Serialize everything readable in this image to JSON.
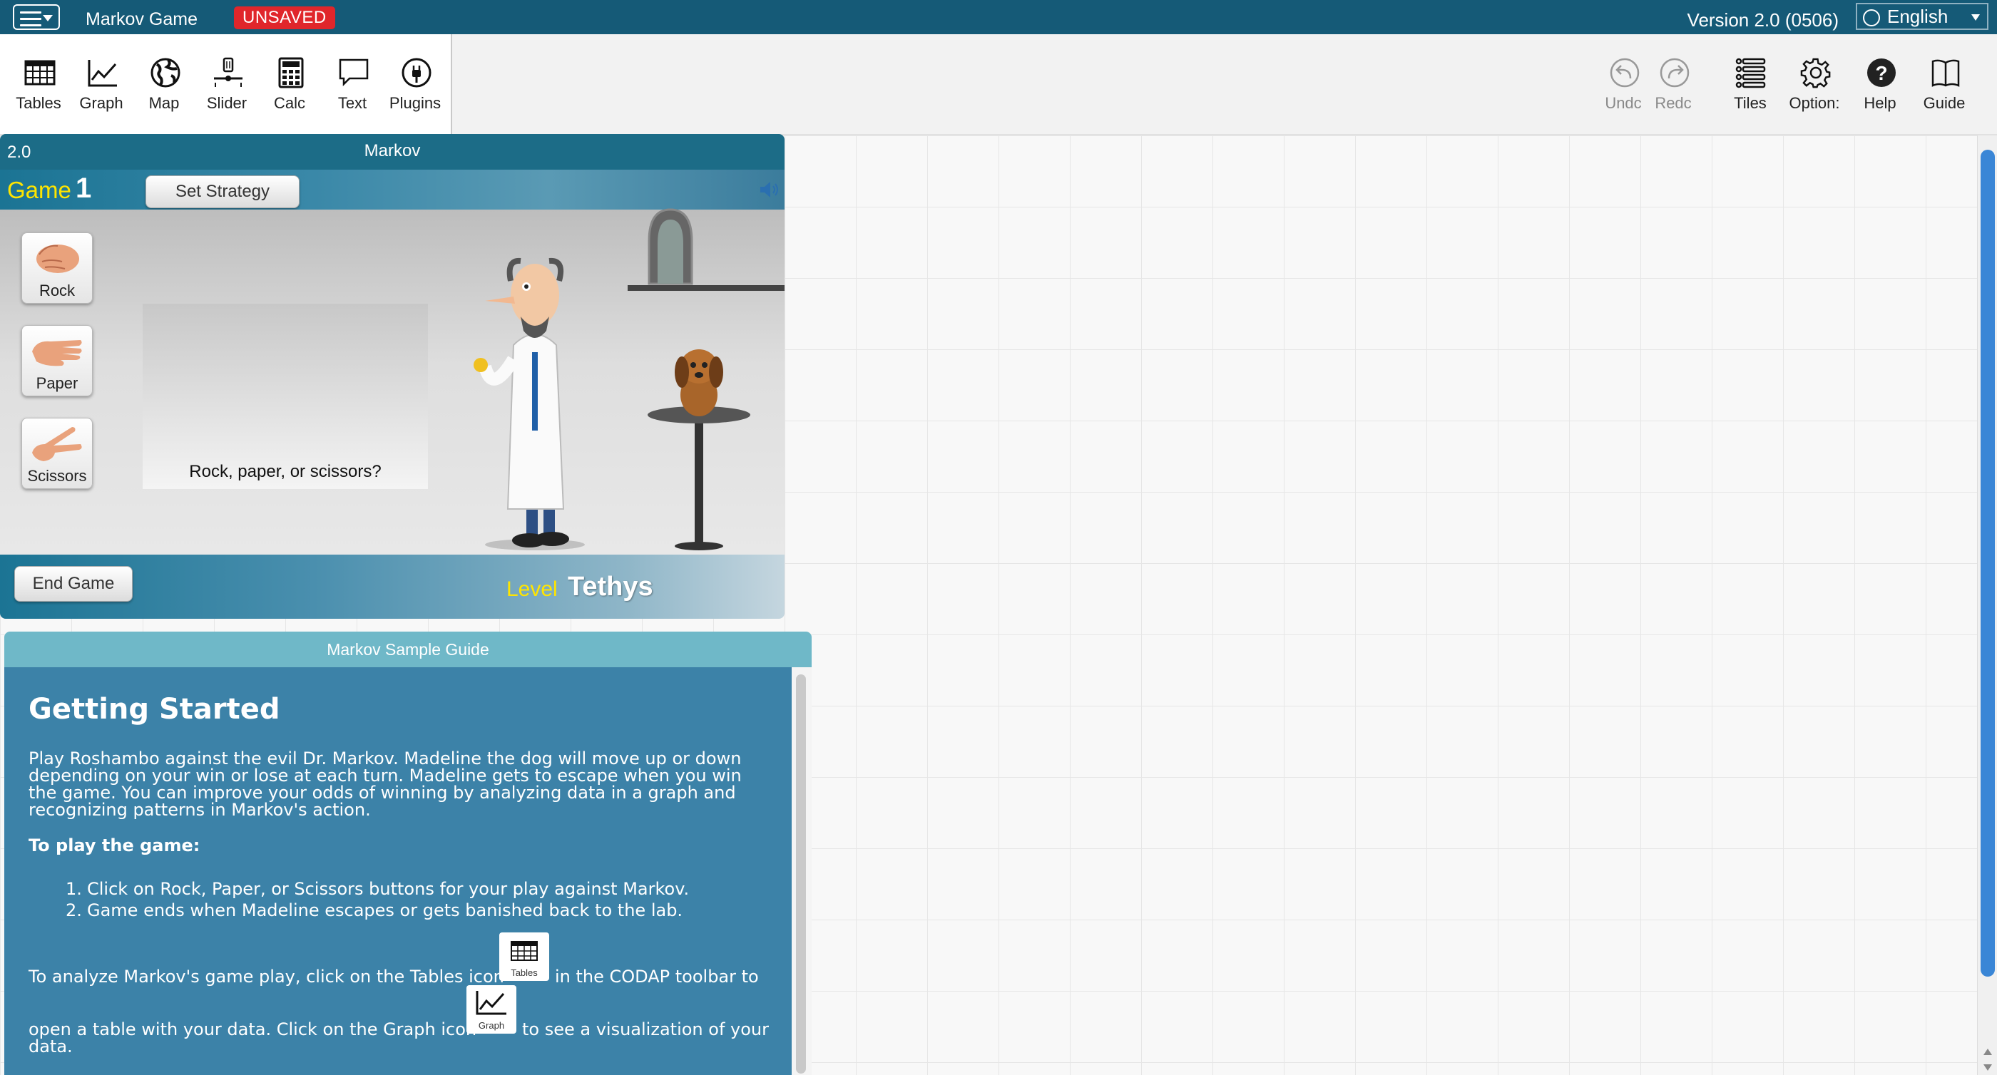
{
  "topbar": {
    "doc_title": "Markov Game",
    "unsaved_badge": "UNSAVED",
    "version": "Version 2.0 (0506)",
    "language": "English",
    "colors": {
      "bar": "#155a77",
      "unsaved": "#e0262b"
    }
  },
  "toolshelf": {
    "left": [
      {
        "label": "Tables",
        "icon": "table-icon"
      },
      {
        "label": "Graph",
        "icon": "graph-icon"
      },
      {
        "label": "Map",
        "icon": "globe-icon"
      },
      {
        "label": "Slider",
        "icon": "slider-icon"
      },
      {
        "label": "Calc",
        "icon": "calculator-icon"
      },
      {
        "label": "Text",
        "icon": "speech-bubble-icon"
      },
      {
        "label": "Plugins",
        "icon": "plug-icon"
      }
    ],
    "right": [
      {
        "label": "Undc",
        "icon": "undo-icon"
      },
      {
        "label": "Redc",
        "icon": "redo-icon"
      },
      {
        "label": "Tiles",
        "icon": "tiles-list-icon"
      },
      {
        "label": "Option:",
        "icon": "gear-icon"
      },
      {
        "label": "Help",
        "icon": "help-icon"
      },
      {
        "label": "Guide",
        "icon": "book-icon"
      }
    ]
  },
  "game_tile": {
    "version": "2.0",
    "title": "Markov",
    "game_label": "Game",
    "game_number": "1",
    "set_strategy": "Set Strategy",
    "hands": [
      "Rock",
      "Paper",
      "Scissors"
    ],
    "prompt": "Rock, paper, or scissors?",
    "end_game": "End Game",
    "level_label": "Level",
    "level_name": "Tethys"
  },
  "guide_tile": {
    "title": "Markov Sample Guide",
    "heading": "Getting Started",
    "intro": "Play Roshambo against the evil Dr. Markov. Madeline the dog will move up or down depending on your win or lose at each turn. Madeline gets to escape when you win the game. You can improve your odds of winning by analyzing data in a graph and recognizing patterns in Markov's action.",
    "to_play": "To play the game:",
    "steps": [
      "Click on Rock, Paper, or Scissors buttons for your play against Markov.",
      "Game ends when Madeline escapes or gets banished back to the lab."
    ],
    "analyze_part1": "To analyze Markov's game play, click on the Tables icon",
    "analyze_part2": "in the CODAP toolbar to",
    "analyze_part3": "open a table with your data. Click on the Graph icon",
    "analyze_part4": "to see a visualization of your",
    "analyze_part5": "data.",
    "mini_tables": "Tables",
    "mini_graph": "Graph"
  }
}
